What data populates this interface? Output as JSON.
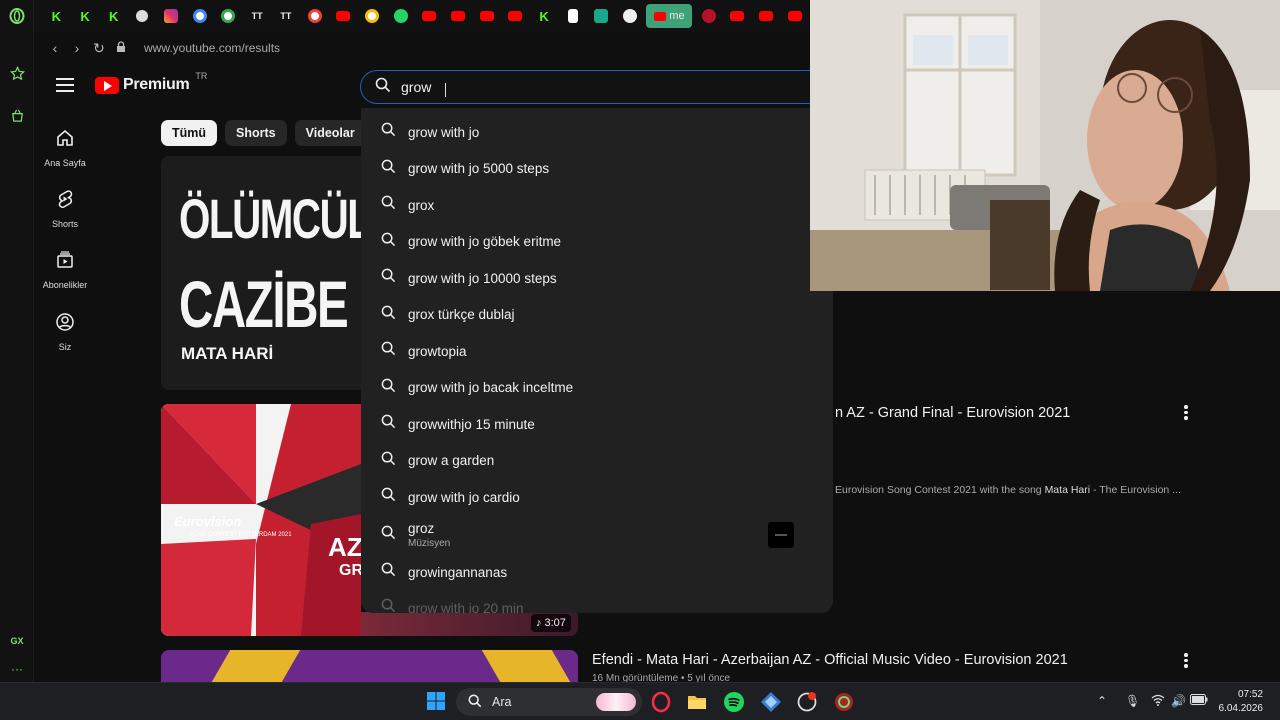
{
  "browser": {
    "url": "www.youtube.com/results",
    "active_tab_label": "me",
    "sidebar_bottom_label": "GX"
  },
  "youtube": {
    "brand": "Premium",
    "country": "TR",
    "search_query": "grow",
    "nav": [
      {
        "label": "Ana Sayfa",
        "icon": "home-icon"
      },
      {
        "label": "Shorts",
        "icon": "shorts-icon"
      },
      {
        "label": "Abonelikler",
        "icon": "subscriptions-icon"
      },
      {
        "label": "Siz",
        "icon": "you-icon"
      }
    ],
    "chips": [
      "Tümü",
      "Shorts",
      "Videolar"
    ],
    "thumb1": {
      "line1": "ÖLÜMCÜL",
      "line2": "CAZİBE",
      "line3": "MATA HARİ"
    },
    "thumb2": {
      "logo": "Eurovision",
      "logo_sub": "SONG CONTEST ROTTERDAM 2021",
      "big": "AZ",
      "big2": "GR"
    },
    "results": [
      {
        "title_visible": "n AZ - Grand Final - Eurovision 2021",
        "desc_prefix": "Eurovision Song Contest 2021 with the song ",
        "desc_bold": "Mata Hari",
        "desc_suffix": " - The Eurovision ...",
        "duration": "3:07"
      },
      {
        "title": "Efendi - Mata Hari - Azerbaijan AZ - Official Music Video - Eurovision 2021",
        "meta": "16 Mn görüntüleme • 5 yıl önce"
      }
    ]
  },
  "suggestions": [
    {
      "text": "grow with jo"
    },
    {
      "text": "grow with jo 5000 steps"
    },
    {
      "text": "grox"
    },
    {
      "text": "grow with jo göbek eritme"
    },
    {
      "text": "grow with jo 10000 steps"
    },
    {
      "text": "grox türkçe dublaj"
    },
    {
      "text": "growtopia"
    },
    {
      "text": "grow with jo bacak inceltme"
    },
    {
      "text": "growwithjo 15 minute"
    },
    {
      "text": "grow a garden"
    },
    {
      "text": "grow with jo cardio"
    },
    {
      "text": "groz",
      "sub": "Müzisyen"
    },
    {
      "text": "growingannanas"
    },
    {
      "text": "grow with jo 20 min"
    }
  ],
  "taskbar": {
    "search_placeholder": "Ara",
    "time": "07:52",
    "date": "6.04.2026"
  },
  "colors": {
    "accent_search_border": "#1c62b9",
    "youtube_red": "#ff0000",
    "opera_green": "#7be26b"
  }
}
